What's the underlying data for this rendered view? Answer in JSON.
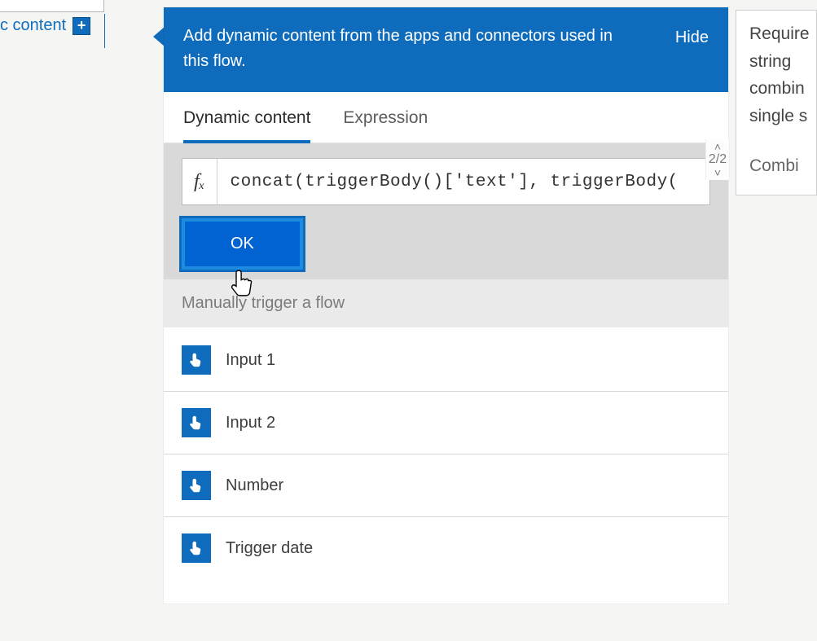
{
  "left_panel": {
    "link_text": "c content",
    "plus_alt": "+"
  },
  "panel": {
    "header_text": "Add dynamic content from the apps and connectors used in this flow.",
    "hide_label": "Hide"
  },
  "tabs": {
    "dynamic": "Dynamic content",
    "expression": "Expression"
  },
  "expression": {
    "fx_label": "fₓ",
    "value": "concat(triggerBody()['text'], triggerBody("
  },
  "ok_label": "OK",
  "section_title": "Manually trigger a flow",
  "items": [
    {
      "label": "Input 1"
    },
    {
      "label": "Input 2"
    },
    {
      "label": "Number"
    },
    {
      "label": "Trigger date"
    }
  ],
  "paginator": {
    "up": "˄",
    "value": "2/2",
    "down": "˅"
  },
  "hint": {
    "line1": "Require",
    "line2": "string",
    "line3": "combin",
    "line4": "single s",
    "secondary": "Combi"
  }
}
